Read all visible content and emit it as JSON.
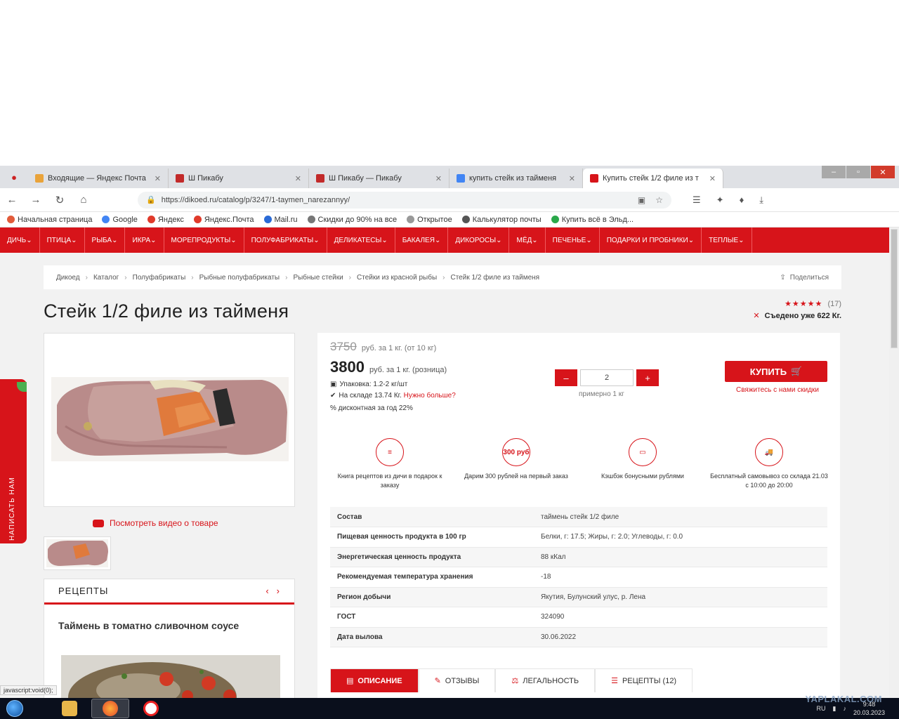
{
  "browser": {
    "tabs": [
      {
        "label": "Входящие — Яндекс Почта",
        "color": "#e9a33a"
      },
      {
        "label": "Ш Пикабу",
        "color": "#c22a2a"
      },
      {
        "label": "Ш Пикабу — Пикабу",
        "color": "#c22a2a"
      },
      {
        "label": "купить стейк из тайменя",
        "color": "#4285f4"
      },
      {
        "label": "Купить стейк 1/2 филе из т",
        "color": "#d7141a",
        "active": true
      }
    ],
    "url": "https://dikoed.ru/catalog/p/3247/1-taymen_narezannyy/",
    "bookmarks": [
      {
        "label": "Начальная страница",
        "color": "#e25b3a"
      },
      {
        "label": "Google",
        "color": "#4285f4"
      },
      {
        "label": "Яндекс",
        "color": "#e03a2a"
      },
      {
        "label": "Яндекс.Почта",
        "color": "#e03a2a"
      },
      {
        "label": "Mail.ru",
        "color": "#2a6ad6"
      },
      {
        "label": "Скидки до 90% на все",
        "color": "#777777"
      },
      {
        "label": "Открытое",
        "color": "#999999"
      },
      {
        "label": "Калькулятор почты",
        "color": "#555555"
      },
      {
        "label": "Купить всё в Эльд...",
        "color": "#2aa84a"
      }
    ]
  },
  "menu": [
    "Дичь",
    "Птица",
    "Рыба",
    "Икра",
    "Морепродукты",
    "Полуфабрикаты",
    "Деликатесы",
    "Бакалея",
    "Дикоросы",
    "Мёд",
    "Печенье",
    "Подарки и пробники",
    "Теплые"
  ],
  "breadcrumbs": [
    "Дикоед",
    "Каталог",
    "Полуфабрикаты",
    "Рыбные полуфабрикаты",
    "Рыбные стейки",
    "Стейки из красной рыбы",
    "Стейк 1/2 филе из тайменя"
  ],
  "share_label": "Поделиться",
  "product": {
    "title": "Стейк 1/2 филе из тайменя",
    "stars": "★★★★★",
    "reviews_count": "(17)",
    "eaten": "Съедено уже 622 Кг.",
    "old_price": "3750",
    "old_price_unit": "руб. за 1 кг. (от 10 кг)",
    "price": "3800",
    "price_unit": "руб. за 1 кг. (розница)",
    "pack": "Упаковка: 1.2-2 кг/шт",
    "stock": "На складе 13.74 Кг.",
    "stock_link": "Нужно больше?",
    "discount_info": "% дисконтная за год 22%",
    "qty_minus": "–",
    "qty_value": "2",
    "qty_plus": "+",
    "qty_note": "примерно 1 кг",
    "buy_label": "КУПИТЬ",
    "discount_link": "Свяжитесь с нами скидки"
  },
  "benefits": [
    {
      "icon": "book-icon",
      "glyph": "≡",
      "text": "Книга рецептов из дичи в подарок к заказу"
    },
    {
      "icon": "bonus-icon",
      "glyph": "300 руб",
      "text": "Дарим 300 рублей на первый заказ"
    },
    {
      "icon": "card-icon",
      "glyph": "▭",
      "text": "Кэшбэк бонусными рублями"
    },
    {
      "icon": "truck-icon",
      "glyph": "🚚",
      "text": "Бесплатный самовывоз со склада 21.03 с 10:00 до 20:00"
    }
  ],
  "specs": [
    {
      "key": "Состав",
      "value": "таймень стейк 1/2 филе"
    },
    {
      "key": "Пищевая ценность продукта в 100 гр",
      "value": "Белки, г: 17.5; Жиры, г: 2.0; Углеводы, г: 0.0"
    },
    {
      "key": "Энергетическая ценность продукта",
      "value": "88 кКал"
    },
    {
      "key": "Рекомендуемая температура хранения",
      "value": "-18"
    },
    {
      "key": "Регион добычи",
      "value": "Якутия, Булунский улус, р. Лена"
    },
    {
      "key": "ГОСТ",
      "value": "324090"
    },
    {
      "key": "Дата вылова",
      "value": "30.06.2022"
    }
  ],
  "product_tabs": [
    {
      "label": "ОПИСАНИЕ",
      "active": true
    },
    {
      "label": "ОТЗЫВЫ"
    },
    {
      "label": "ЛЕГАЛЬНОСТЬ"
    },
    {
      "label": "РЕЦЕПТЫ (12)"
    }
  ],
  "video_link": "Посмотреть видео о товаре",
  "recipes": {
    "heading": "РЕЦЕПТЫ",
    "title": "Таймень в томатно сливочном соусе"
  },
  "side_widget": "НАПИСАТЬ НАМ",
  "status_bar_url": "javascript:void(0);",
  "taskbar": {
    "lang": "RU",
    "time": "9:48",
    "date": "20.03.2023"
  },
  "watermark": "YAPLAKAL.COM",
  "colors": {
    "brand_red": "#d7141a",
    "page_bg": "#f2f2f2"
  }
}
